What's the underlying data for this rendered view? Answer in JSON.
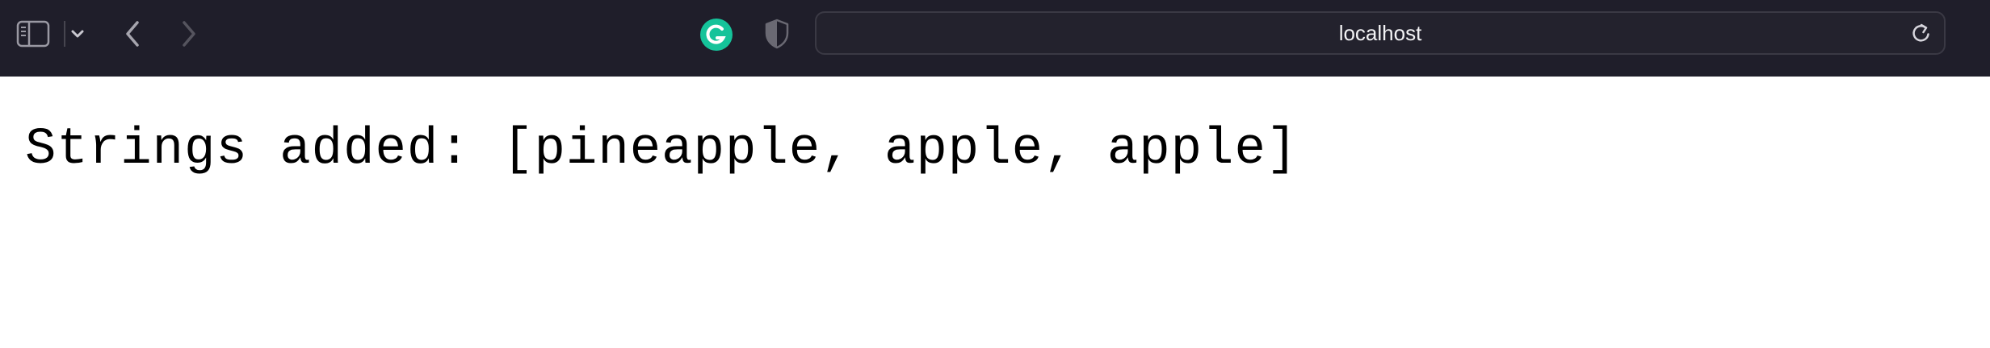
{
  "toolbar": {
    "address": "localhost",
    "icons": {
      "sidebar": "sidebar-icon",
      "chevron": "chevron-down-icon",
      "back": "back-arrow-icon",
      "forward": "forward-arrow-icon",
      "extension": "grammarly-icon",
      "privacy": "shield-icon",
      "reload": "reload-icon"
    }
  },
  "page": {
    "text": "Strings added: [pineapple, apple, apple]"
  },
  "colors": {
    "toolbar_bg": "#1f1e2a",
    "grammarly": "#15c39a",
    "page_bg": "#ffffff"
  }
}
